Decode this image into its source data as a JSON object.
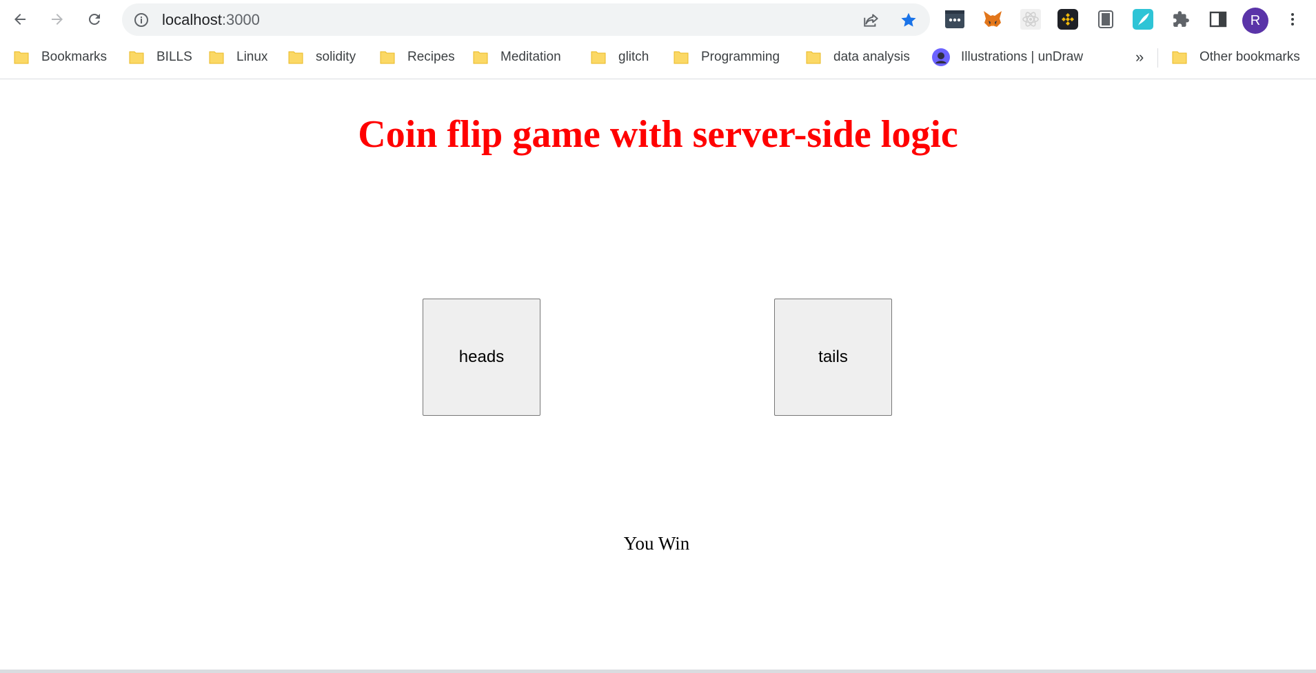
{
  "browser": {
    "url_host": "localhost",
    "url_port": ":3000",
    "avatar_letter": "R",
    "extensions": [
      "password-manager-icon",
      "metamask-fox-icon",
      "react-devtools-icon",
      "binance-wallet-icon",
      "device-toolbar-icon",
      "feather-extension-icon",
      "puzzle-extensions-icon",
      "side-panel-icon"
    ]
  },
  "bookmarks": {
    "items": [
      {
        "label": "Bookmarks"
      },
      {
        "label": "BILLS"
      },
      {
        "label": "Linux"
      },
      {
        "label": "solidity"
      },
      {
        "label": "Recipes"
      },
      {
        "label": "Meditation"
      },
      {
        "label": "glitch"
      },
      {
        "label": "Programming"
      },
      {
        "label": "data analysis"
      },
      {
        "label": "Illustrations | unDraw"
      }
    ],
    "overflow": "»",
    "other": "Other bookmarks"
  },
  "page": {
    "title": "Coin flip game with server-side logic",
    "heads_label": "heads",
    "tails_label": "tails",
    "result": "You Win"
  },
  "colors": {
    "title": "#ff0000",
    "folder": "#fbd865",
    "star": "#1a73e8",
    "avatar": "#5a34a8"
  }
}
